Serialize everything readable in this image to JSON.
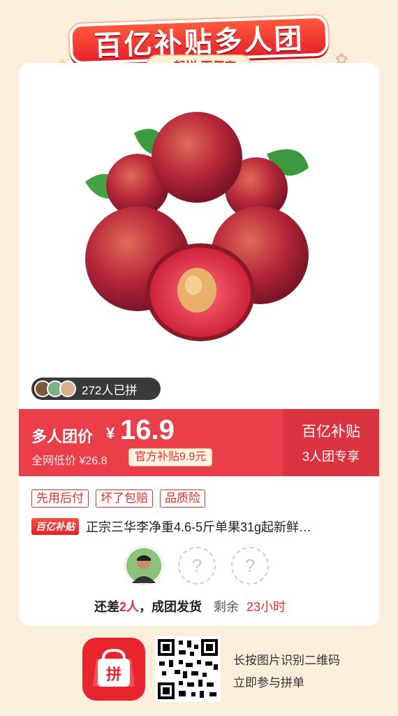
{
  "banner": {
    "title": "百亿补贴多人团",
    "subtitle": "一起拼 更便宜"
  },
  "product": {
    "image_icon": "plums-image",
    "joined_count": "272人已拼",
    "group_price_label": "多人团价",
    "currency": "¥",
    "price": "16.9",
    "market_price": "全网低价 ¥26.8",
    "subsidy_tag": "官方补贴9.9元",
    "promo_title": "百亿补贴",
    "promo_subtitle": "3人团专享",
    "tags": [
      "先用后付",
      "坏了包赔",
      "品质险"
    ],
    "brand_badge": "百亿补贴",
    "title": "正宗三华李净重4.6-5斤单果31g起新鲜…"
  },
  "group": {
    "slots": [
      {
        "type": "user",
        "icon": "avatar"
      },
      {
        "type": "empty",
        "icon": "question-mark-icon",
        "label": "?"
      },
      {
        "type": "empty",
        "icon": "question-mark-icon",
        "label": "?"
      }
    ],
    "status_prefix": "还差",
    "status_count": "2人",
    "status_suffix": "，成团发货",
    "remaining_label": "剩余",
    "remaining_time": "23小时"
  },
  "footer": {
    "scan_line1": "长按图片识别二维码",
    "scan_line2": "立即参与拼单"
  },
  "colors": {
    "background": "#fbeedb",
    "accent_red": "#ea3f4a",
    "dark_red": "#dc3340",
    "tag_red": "#e3322c"
  }
}
